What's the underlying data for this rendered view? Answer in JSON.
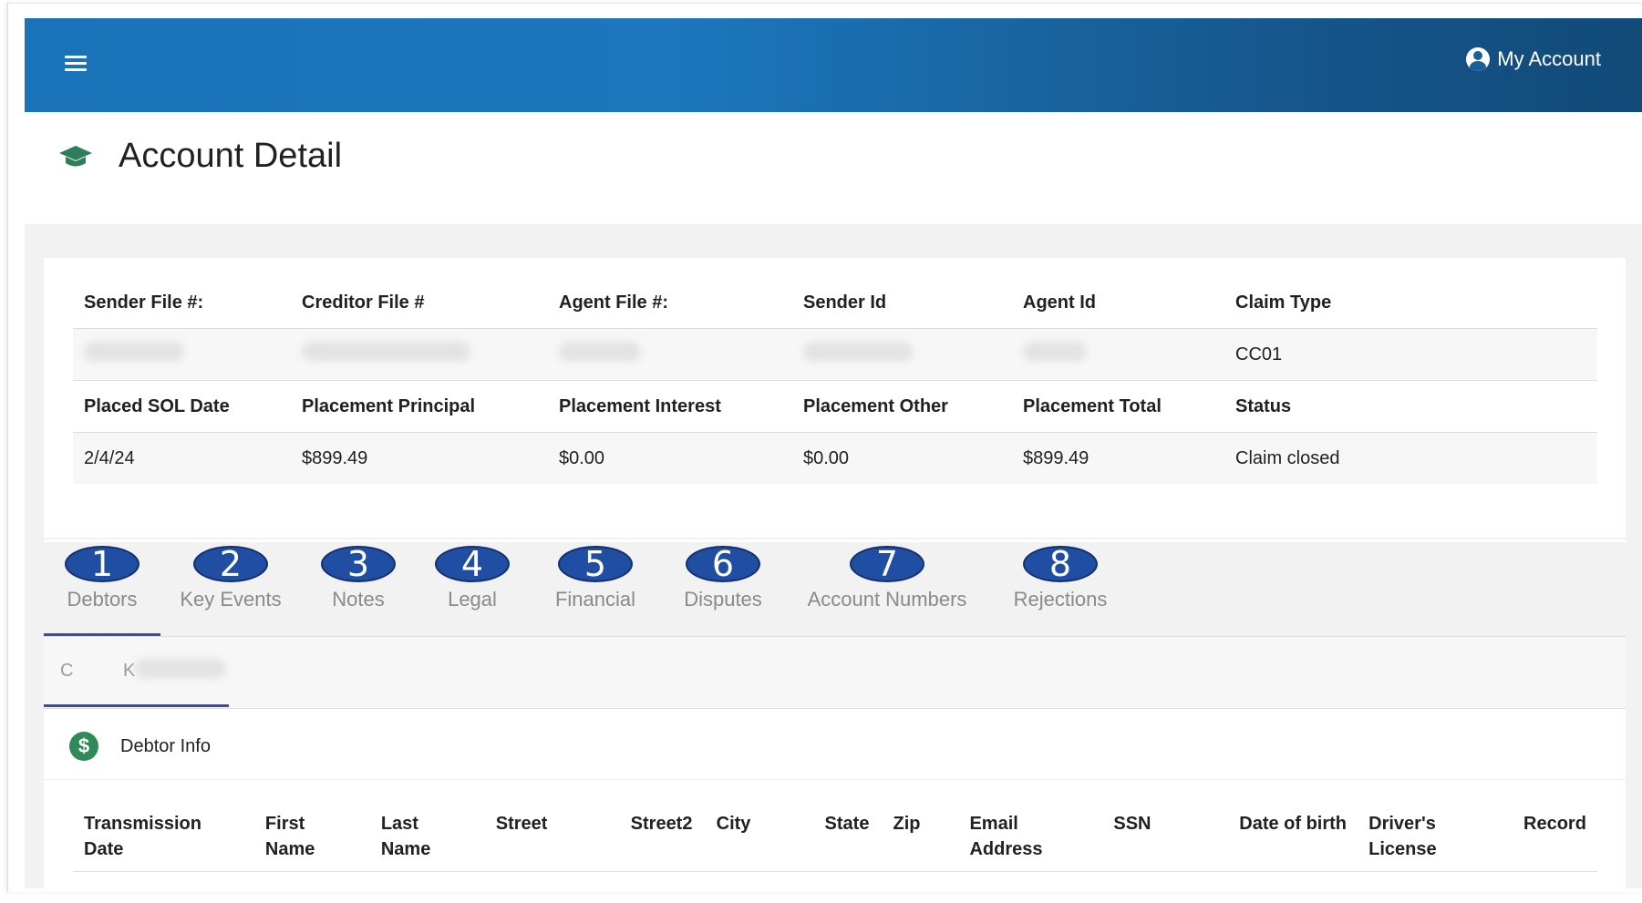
{
  "header": {
    "menu_icon": "hamburger-icon",
    "account_label": "My Account",
    "account_icon": "user-circle-icon"
  },
  "page": {
    "title": "Account Detail",
    "title_icon": "graduation-cap-icon"
  },
  "summary": {
    "row1_headers": [
      "Sender File #:",
      "Creditor File #",
      "Agent File #:",
      "Sender Id",
      "Agent Id",
      "Claim Type"
    ],
    "row1_values": [
      "",
      "",
      "",
      "",
      "",
      "CC01"
    ],
    "row2_headers": [
      "Placed SOL Date",
      "Placement Principal",
      "Placement Interest",
      "Placement Other",
      "Placement Total",
      "Status"
    ],
    "row2_values": [
      "2/4/24",
      "$899.49",
      "$0.00",
      "$0.00",
      "$899.49",
      "Claim closed"
    ]
  },
  "tabs": [
    {
      "badge": "1",
      "label": "Debtors",
      "active": true
    },
    {
      "badge": "2",
      "label": "Key Events"
    },
    {
      "badge": "3",
      "label": "Notes"
    },
    {
      "badge": "4",
      "label": "Legal"
    },
    {
      "badge": "5",
      "label": "Financial"
    },
    {
      "badge": "6",
      "label": "Disputes"
    },
    {
      "badge": "7",
      "label": "Account Numbers"
    },
    {
      "badge": "8",
      "label": "Rejections"
    }
  ],
  "debtor_subtab": {
    "initial1": "C",
    "initial2": "K"
  },
  "debtor_section": {
    "icon": "dollar-circle-icon",
    "title": "Debtor Info",
    "columns": [
      [
        "Transmission",
        "Date"
      ],
      [
        "First",
        "Name"
      ],
      [
        "Last",
        "Name"
      ],
      [
        "Street",
        ""
      ],
      [
        "Street2",
        ""
      ],
      [
        "City",
        ""
      ],
      [
        "State",
        ""
      ],
      [
        "Zip",
        ""
      ],
      [
        "Email",
        "Address"
      ],
      [
        "SSN",
        ""
      ],
      [
        "Date of birth",
        ""
      ],
      [
        "Driver's",
        "License"
      ],
      [
        "Record",
        ""
      ]
    ]
  }
}
